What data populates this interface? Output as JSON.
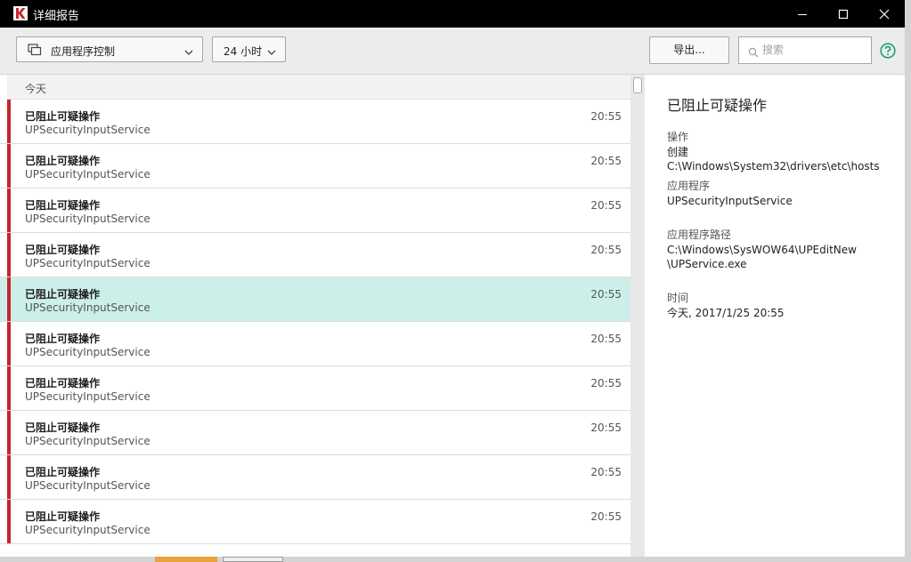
{
  "window": {
    "title": "详细报告"
  },
  "toolbar": {
    "component_select": "应用程序控制",
    "period_select": "24 小时",
    "export_label": "导出...",
    "search_placeholder": "搜索"
  },
  "list": {
    "group_label": "今天",
    "items": [
      {
        "title": "已阻止可疑操作",
        "subtitle": "UPSecurityInputService",
        "time": "20:55",
        "selected": false
      },
      {
        "title": "已阻止可疑操作",
        "subtitle": "UPSecurityInputService",
        "time": "20:55",
        "selected": false
      },
      {
        "title": "已阻止可疑操作",
        "subtitle": "UPSecurityInputService",
        "time": "20:55",
        "selected": false
      },
      {
        "title": "已阻止可疑操作",
        "subtitle": "UPSecurityInputService",
        "time": "20:55",
        "selected": false
      },
      {
        "title": "已阻止可疑操作",
        "subtitle": "UPSecurityInputService",
        "time": "20:55",
        "selected": true
      },
      {
        "title": "已阻止可疑操作",
        "subtitle": "UPSecurityInputService",
        "time": "20:55",
        "selected": false
      },
      {
        "title": "已阻止可疑操作",
        "subtitle": "UPSecurityInputService",
        "time": "20:55",
        "selected": false
      },
      {
        "title": "已阻止可疑操作",
        "subtitle": "UPSecurityInputService",
        "time": "20:55",
        "selected": false
      },
      {
        "title": "已阻止可疑操作",
        "subtitle": "UPSecurityInputService",
        "time": "20:55",
        "selected": false
      },
      {
        "title": "已阻止可疑操作",
        "subtitle": "UPSecurityInputService",
        "time": "20:55",
        "selected": false
      }
    ]
  },
  "detail": {
    "title": "已阻止可疑操作",
    "operation_label": "操作",
    "operation_value": "创建 C:\\Windows\\System32\\drivers\\etc\\hosts",
    "application_label": "应用程序",
    "application_value": "UPSecurityInputService",
    "path_label": "应用程序路径",
    "path_line1": "C:\\Windows\\SysWOW64\\UPEditNew",
    "path_line2": "\\UPService.exe",
    "time_label": "时间",
    "time_value": "今天, 2017/1/25 20:55"
  },
  "colors": {
    "accent_red": "#c4262e",
    "selected_row": "#ccf0e9",
    "help_green": "#1aa17a",
    "titlebar": "#000000"
  },
  "icons": {
    "app": "kaspersky-k-icon",
    "component": "copy-window-icon",
    "search": "search-icon",
    "help": "help-circle-icon"
  }
}
